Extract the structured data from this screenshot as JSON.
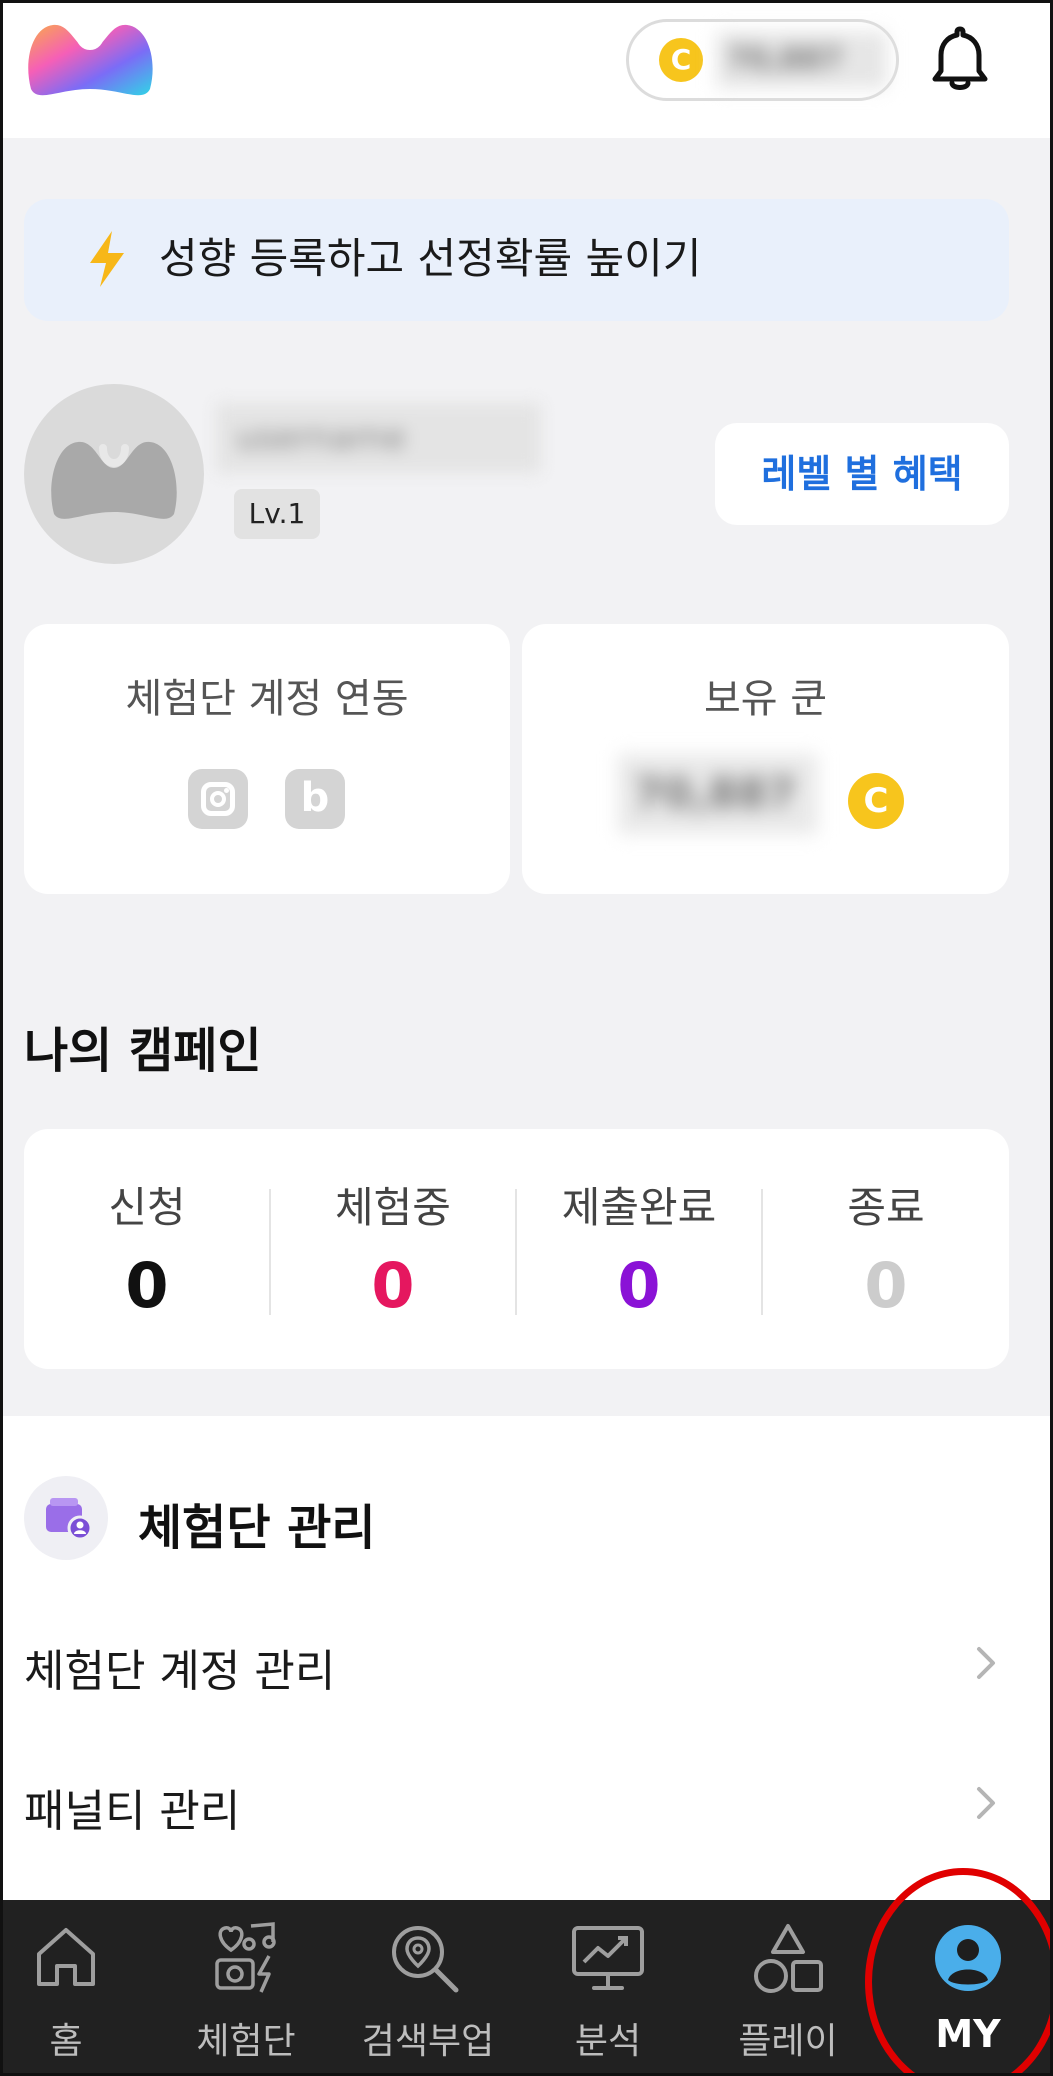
{
  "header": {
    "coin_symbol": "C",
    "coin_balance": "70,887"
  },
  "banner": {
    "text": "성향 등록하고 선정확률 높이기"
  },
  "profile": {
    "name": "username",
    "level": "Lv.1",
    "level_benefits_label": "레벨 별 혜택"
  },
  "cards": {
    "account_link_title": "체험단 계정 연동",
    "blog_icon_letter": "b",
    "coins_title": "보유 쿤",
    "coins_amount": "70,887",
    "coin_symbol": "C"
  },
  "campaign": {
    "title": "나의 캠페인",
    "stats": [
      {
        "label": "신청",
        "value": "0",
        "color": "#111111"
      },
      {
        "label": "체험중",
        "value": "0",
        "color": "#e5175f"
      },
      {
        "label": "제출완료",
        "value": "0",
        "color": "#8a12d6"
      },
      {
        "label": "종료",
        "value": "0",
        "color": "#cccccc"
      }
    ]
  },
  "management": {
    "title": "체험단 관리",
    "items": [
      {
        "label": "체험단 계정 관리"
      },
      {
        "label": "패널티 관리"
      }
    ]
  },
  "bottom_nav": {
    "items": [
      {
        "label": "홈",
        "icon": "home-icon"
      },
      {
        "label": "체험단",
        "icon": "experience-icon"
      },
      {
        "label": "검색부업",
        "icon": "search-location-icon"
      },
      {
        "label": "분석",
        "icon": "analytics-icon"
      },
      {
        "label": "플레이",
        "icon": "shapes-icon"
      },
      {
        "label": "MY",
        "icon": "profile-icon",
        "active": true
      }
    ]
  },
  "colors": {
    "accent_blue": "#1f6fde",
    "coin_yellow": "#f7c51d",
    "nav_bg": "#212121",
    "highlight_red": "#e00000"
  }
}
